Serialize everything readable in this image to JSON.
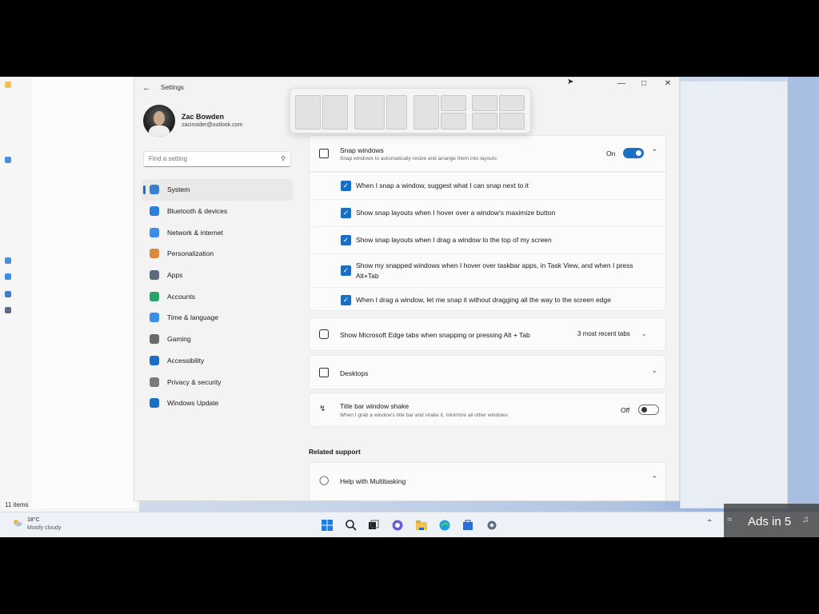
{
  "settings": {
    "title": "Settings",
    "user": {
      "name": "Zac Bowden",
      "email": "zacinsider@outlook.com"
    },
    "search_placeholder": "Find a setting",
    "nav": [
      {
        "label": "System",
        "icon": "system-icon",
        "color": "#3b7fd1"
      },
      {
        "label": "Bluetooth & devices",
        "icon": "bluetooth-icon",
        "color": "#2e7fd8"
      },
      {
        "label": "Network & internet",
        "icon": "network-icon",
        "color": "#3a8ee6"
      },
      {
        "label": "Personalization",
        "icon": "brush-icon",
        "color": "#d98a3d"
      },
      {
        "label": "Apps",
        "icon": "apps-icon",
        "color": "#5b6b80"
      },
      {
        "label": "Accounts",
        "icon": "accounts-icon",
        "color": "#2aa36b"
      },
      {
        "label": "Time & language",
        "icon": "globe-clock-icon",
        "color": "#3a8ee6"
      },
      {
        "label": "Gaming",
        "icon": "controller-icon",
        "color": "#6b6b6b"
      },
      {
        "label": "Accessibility",
        "icon": "accessibility-icon",
        "color": "#1a6fc4"
      },
      {
        "label": "Privacy & security",
        "icon": "shield-icon",
        "color": "#7a7a7a"
      },
      {
        "label": "Windows Update",
        "icon": "update-icon",
        "color": "#1a6fc4"
      }
    ],
    "snap": {
      "title": "Snap windows",
      "subtitle": "Snap windows to automatically resize and arrange them into layouts",
      "state": "On",
      "options": [
        "When I snap a window, suggest what I can snap next to it",
        "Show snap layouts when I hover over a window's maximize button",
        "Show snap layouts when I drag a window to the top of my screen",
        "Show my snapped windows when I hover over taskbar apps, in Task View, and when I press Alt+Tab",
        "When I drag a window, let me snap it without dragging all the way to the screen edge"
      ]
    },
    "edge_tabs": {
      "title": "Show Microsoft Edge tabs when snapping or pressing Alt + Tab",
      "value": "3 most recent tabs"
    },
    "desktops": {
      "title": "Desktops"
    },
    "shake": {
      "title": "Title bar window shake",
      "subtitle": "When I grab a window's title bar and shake it, minimize all other windows",
      "state": "Off"
    },
    "related_support": "Related support",
    "help": "Help with Multitasking"
  },
  "taskbar": {
    "weather_temp": "18°C",
    "weather_condition": "Mostly cloudy"
  },
  "overlay": {
    "ads_text": "Ads in 5"
  },
  "explorer": {
    "status": "11 items"
  },
  "colors": {
    "accent": "#1a6fc4"
  }
}
